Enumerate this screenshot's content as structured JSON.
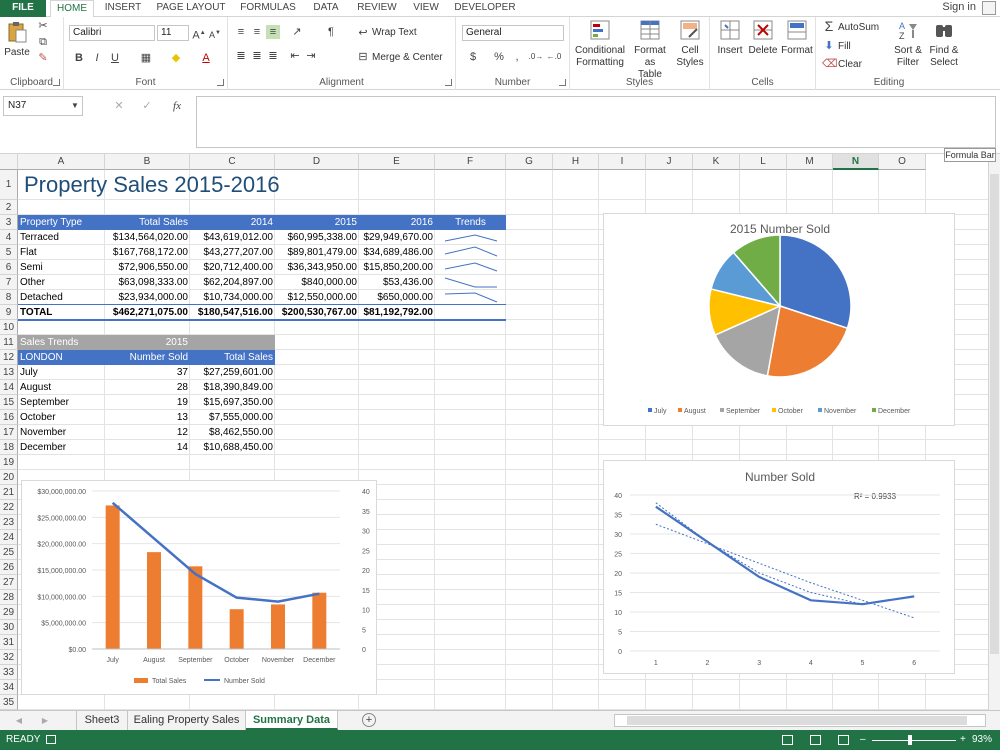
{
  "ribbon_tabs": [
    "FILE",
    "HOME",
    "INSERT",
    "PAGE LAYOUT",
    "FORMULAS",
    "DATA",
    "REVIEW",
    "VIEW",
    "DEVELOPER"
  ],
  "signin": "Sign in",
  "clipboard": {
    "paste": "Paste",
    "label": "Clipboard"
  },
  "font": {
    "family": "Calibri",
    "size": "11",
    "bold": "B",
    "italic": "I",
    "underline": "U",
    "label": "Font"
  },
  "alignment": {
    "wrap": "Wrap Text",
    "merge": "Merge & Center",
    "label": "Alignment"
  },
  "number": {
    "format": "General",
    "currency": "$",
    "percent": "%",
    "comma": ",",
    "label": "Number"
  },
  "styles": {
    "cond1": "Conditional",
    "cond2": "Formatting",
    "fmt1": "Format as",
    "fmt2": "Table",
    "cell1": "Cell",
    "cell2": "Styles",
    "label": "Styles"
  },
  "cells": {
    "insert": "Insert",
    "delete": "Delete",
    "format": "Format",
    "label": "Cells"
  },
  "editing": {
    "autosum": "AutoSum",
    "fill": "Fill",
    "clear": "Clear",
    "sort1": "Sort &",
    "sort2": "Filter",
    "find1": "Find &",
    "find2": "Select",
    "label": "Editing"
  },
  "formula_bar": {
    "name_box": "N37",
    "fx": "fx",
    "tooltip": "Formula Bar"
  },
  "columns": [
    "A",
    "B",
    "C",
    "D",
    "E",
    "F",
    "G",
    "H",
    "I",
    "J",
    "K",
    "L",
    "M",
    "N",
    "O"
  ],
  "selected_column": "N",
  "rows": [
    "1",
    "2",
    "3",
    "4",
    "5",
    "6",
    "7",
    "8",
    "9",
    "10",
    "11",
    "12",
    "13",
    "14",
    "15",
    "16",
    "17",
    "18",
    "19",
    "20",
    "21",
    "22",
    "23",
    "24",
    "25",
    "26",
    "27",
    "28",
    "29",
    "30",
    "31",
    "32",
    "33",
    "34",
    "35"
  ],
  "sheet": {
    "title": "Property Sales 2015-2016",
    "table1": {
      "headers": [
        "Property Type",
        "Total Sales",
        "2014",
        "2015",
        "2016",
        "Trends"
      ],
      "rows": [
        [
          "Terraced",
          "$134,564,020.00",
          "$43,619,012.00",
          "$60,995,338.00",
          "$29,949,670.00"
        ],
        [
          "Flat",
          "$167,768,172.00",
          "$43,277,207.00",
          "$89,801,479.00",
          "$34,689,486.00"
        ],
        [
          "Semi",
          "$72,906,550.00",
          "$20,712,400.00",
          "$36,343,950.00",
          "$15,850,200.00"
        ],
        [
          "Other",
          "$63,098,333.00",
          "$62,204,897.00",
          "$840,000.00",
          "$53,436.00"
        ],
        [
          "Detached",
          "$23,934,000.00",
          "$10,734,000.00",
          "$12,550,000.00",
          "$650,000.00"
        ]
      ],
      "total": [
        "TOTAL",
        "$462,271,075.00",
        "$180,547,516.00",
        "$200,530,767.00",
        "$81,192,792.00"
      ]
    },
    "table2": {
      "title": "Sales Trends",
      "year": "2015",
      "headers": [
        "LONDON",
        "Number Sold",
        "Total Sales"
      ],
      "rows": [
        [
          "July",
          "37",
          "$27,259,601.00"
        ],
        [
          "August",
          "28",
          "$18,390,849.00"
        ],
        [
          "September",
          "19",
          "$15,697,350.00"
        ],
        [
          "October",
          "13",
          "$7,555,000.00"
        ],
        [
          "November",
          "12",
          "$8,462,550.00"
        ],
        [
          "December",
          "14",
          "$10,688,450.00"
        ]
      ]
    }
  },
  "sheet_tabs": [
    "Sheet3",
    "Ealing Property Sales",
    "Summary Data"
  ],
  "active_sheet": "Summary Data",
  "status": {
    "ready": "READY",
    "zoom": "93%"
  },
  "colors": {
    "accent": "#217346",
    "blue": "#4472c4",
    "orange": "#ed7d31",
    "gray": "#a5a5a5",
    "yellow": "#ffc000",
    "lightblue": "#5b9bd5",
    "green": "#70ad47"
  },
  "chart_data": [
    {
      "type": "pie",
      "title": "2015 Number Sold",
      "categories": [
        "July",
        "August",
        "September",
        "October",
        "November",
        "December"
      ],
      "values": [
        37,
        28,
        19,
        13,
        12,
        14
      ],
      "colors": [
        "#4472c4",
        "#ed7d31",
        "#a5a5a5",
        "#ffc000",
        "#5b9bd5",
        "#70ad47"
      ],
      "legend": "bottom"
    },
    {
      "type": "bar",
      "title": "",
      "categories": [
        "July",
        "August",
        "September",
        "October",
        "November",
        "December"
      ],
      "series": [
        {
          "name": "Total Sales",
          "type": "bar",
          "values": [
            27259601,
            18390849,
            15697350,
            7555000,
            8462550,
            10688450
          ],
          "color": "#ed7d31",
          "axis": "left"
        },
        {
          "name": "Number Sold",
          "type": "line",
          "values": [
            37,
            28,
            19,
            13,
            12,
            14
          ],
          "color": "#4472c4",
          "axis": "right"
        }
      ],
      "ylim": [
        0,
        30000000
      ],
      "yticks": [
        "$0.00",
        "$5,000,000.00",
        "$10,000,000.00",
        "$15,000,000.00",
        "$20,000,000.00",
        "$25,000,000.00",
        "$30,000,000.00"
      ],
      "y2lim": [
        0,
        40
      ],
      "y2ticks": [
        "0",
        "5",
        "10",
        "15",
        "20",
        "25",
        "30",
        "35",
        "40"
      ],
      "legend": "bottom"
    },
    {
      "type": "line",
      "title": "Number Sold",
      "x": [
        1,
        2,
        3,
        4,
        5,
        6
      ],
      "xticks": [
        "1",
        "2",
        "3",
        "4",
        "5",
        "6"
      ],
      "series": [
        {
          "values": [
            37,
            28,
            19,
            13,
            12,
            14
          ],
          "color": "#4472c4"
        }
      ],
      "trendline": {
        "values": [
          38,
          28,
          20,
          15,
          12,
          14
        ],
        "linear": [
          32.5,
          27.5,
          22.5,
          17.5,
          13,
          8.5
        ]
      },
      "r2_label": "R² = 0.9933",
      "ylim": [
        0,
        40
      ],
      "yticks": [
        "0",
        "5",
        "10",
        "15",
        "20",
        "25",
        "30",
        "35",
        "40"
      ],
      "grid": true
    }
  ]
}
